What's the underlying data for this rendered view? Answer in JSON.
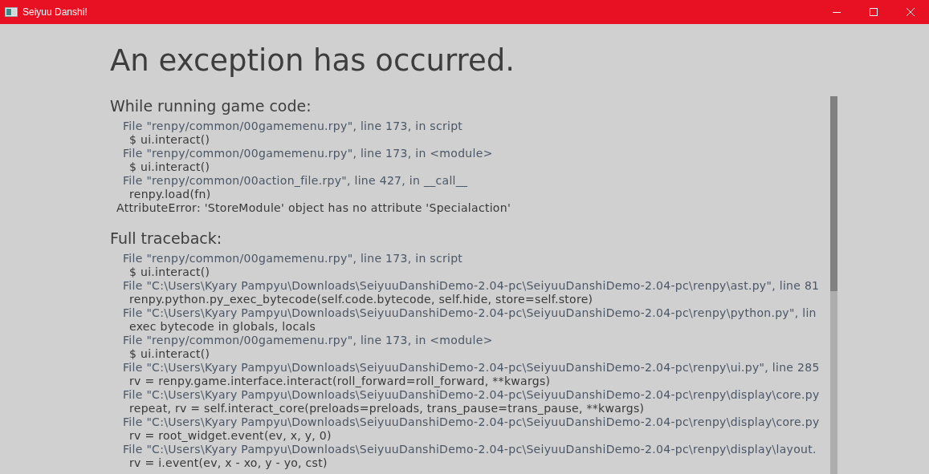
{
  "window": {
    "title": "Seiyuu Danshi!"
  },
  "heading": "An exception has occurred.",
  "sections": [
    {
      "title": "While running game code:",
      "lines": [
        {
          "kind": "file",
          "text": "File \"renpy/common/00gamemenu.rpy\", line 173, in script"
        },
        {
          "kind": "code",
          "text": "$ ui.interact()"
        },
        {
          "kind": "file",
          "text": "File \"renpy/common/00gamemenu.rpy\", line 173, in <module>"
        },
        {
          "kind": "code",
          "text": "$ ui.interact()"
        },
        {
          "kind": "file",
          "text": "File \"renpy/common/00action_file.rpy\", line 427, in __call__"
        },
        {
          "kind": "code",
          "text": "renpy.load(fn)"
        },
        {
          "kind": "error",
          "text": "AttributeError: 'StoreModule' object has no attribute 'Specialaction'"
        }
      ]
    },
    {
      "title": "Full traceback:",
      "lines": [
        {
          "kind": "file",
          "text": "File \"renpy/common/00gamemenu.rpy\", line 173, in script"
        },
        {
          "kind": "code",
          "text": "$ ui.interact()"
        },
        {
          "kind": "file",
          "text": "File \"C:\\Users\\Kyary Pampyu\\Downloads\\SeiyuuDanshiDemo-2.04-pc\\SeiyuuDanshiDemo-2.04-pc\\renpy\\ast.py\", line 81"
        },
        {
          "kind": "code",
          "text": "renpy.python.py_exec_bytecode(self.code.bytecode, self.hide, store=self.store)"
        },
        {
          "kind": "file",
          "text": "File \"C:\\Users\\Kyary Pampyu\\Downloads\\SeiyuuDanshiDemo-2.04-pc\\SeiyuuDanshiDemo-2.04-pc\\renpy\\python.py\", lin"
        },
        {
          "kind": "code",
          "text": "exec bytecode in globals, locals"
        },
        {
          "kind": "file",
          "text": "File \"renpy/common/00gamemenu.rpy\", line 173, in <module>"
        },
        {
          "kind": "code",
          "text": "$ ui.interact()"
        },
        {
          "kind": "file",
          "text": "File \"C:\\Users\\Kyary Pampyu\\Downloads\\SeiyuuDanshiDemo-2.04-pc\\SeiyuuDanshiDemo-2.04-pc\\renpy\\ui.py\", line 285"
        },
        {
          "kind": "code",
          "text": "rv = renpy.game.interface.interact(roll_forward=roll_forward, **kwargs)"
        },
        {
          "kind": "file",
          "text": "File \"C:\\Users\\Kyary Pampyu\\Downloads\\SeiyuuDanshiDemo-2.04-pc\\SeiyuuDanshiDemo-2.04-pc\\renpy\\display\\core.py"
        },
        {
          "kind": "code",
          "text": "repeat, rv = self.interact_core(preloads=preloads, trans_pause=trans_pause, **kwargs)"
        },
        {
          "kind": "file",
          "text": "File \"C:\\Users\\Kyary Pampyu\\Downloads\\SeiyuuDanshiDemo-2.04-pc\\SeiyuuDanshiDemo-2.04-pc\\renpy\\display\\core.py"
        },
        {
          "kind": "code",
          "text": "rv = root_widget.event(ev, x, y, 0)"
        },
        {
          "kind": "file",
          "text": "File \"C:\\Users\\Kyary Pampyu\\Downloads\\SeiyuuDanshiDemo-2.04-pc\\SeiyuuDanshiDemo-2.04-pc\\renpy\\display\\layout."
        },
        {
          "kind": "code",
          "text": "rv = i.event(ev, x - xo, y - yo, cst)"
        }
      ]
    }
  ]
}
